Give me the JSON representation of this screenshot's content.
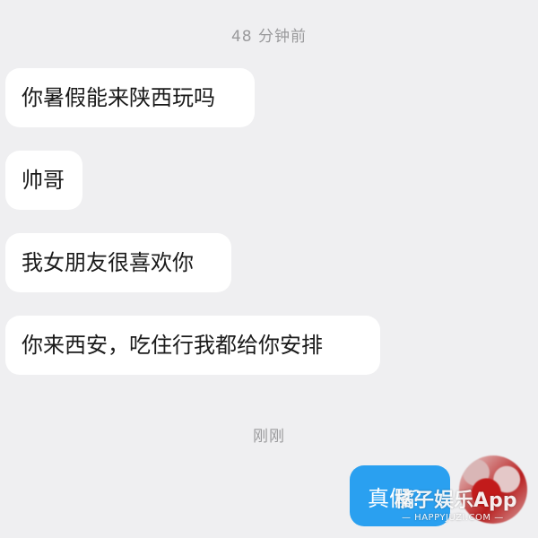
{
  "chat": {
    "timestamps": [
      "48 分钟前",
      "刚刚"
    ],
    "incoming": [
      "你暑假能来陕西玩吗",
      "帅哥",
      "我女朋友很喜欢你",
      "你来西安，吃住行我都给你安排"
    ],
    "outgoing": [
      "真假?"
    ]
  },
  "watermark": {
    "brand": "橘子娱乐App",
    "url": "— HAPPYJUZI.COM —"
  },
  "colors": {
    "background": "#efeff1",
    "incoming_bubble": "#ffffff",
    "outgoing_bubble": "#2aa0f0",
    "timestamp_text": "#9a9a9c"
  }
}
